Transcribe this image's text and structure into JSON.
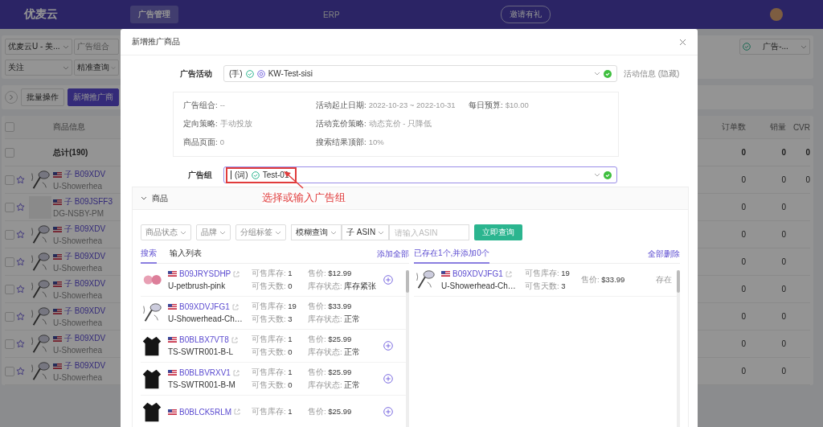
{
  "header": {
    "logo": "优麦云",
    "nav": [
      {
        "label": "广告管理",
        "selected": true
      },
      {
        "label": "ERP",
        "selected": false
      }
    ],
    "invite_button": "邀请有礼"
  },
  "filters": {
    "store": "优麦云U - 美...",
    "portfolio_placeholder": "广告组合",
    "follow": "关注",
    "search_mode": "精准查询",
    "ad_status": "广告-..."
  },
  "toolbar": {
    "bulk_button": "批量操作",
    "add_button": "新增推广商"
  },
  "table": {
    "columns": [
      "商品信息",
      "订单数",
      "销量",
      "CVR"
    ],
    "header_checked": false,
    "total": {
      "label": "总计(190)",
      "checked": false,
      "orders": "0",
      "sales": "0",
      "cvr": "0"
    },
    "rows": [
      {
        "kind": "showerhead",
        "checked": false,
        "asin": "子 B09XDV",
        "name": "U-Showerhea",
        "orders": "0",
        "sales": "0",
        "cvr": "0"
      },
      {
        "kind": "blank",
        "checked": false,
        "asin": "子 B09JSFF3",
        "name": "DG-NSBY-PM",
        "orders": "0",
        "sales": "0"
      },
      {
        "kind": "showerhead",
        "checked": false,
        "asin": "子 B09XDV",
        "name": "U-Showerhea",
        "orders": "0",
        "sales": "0"
      },
      {
        "kind": "showerhead",
        "checked": false,
        "asin": "子 B09XDV",
        "name": "U-Showerhea",
        "orders": "0",
        "sales": "0"
      },
      {
        "kind": "showerhead",
        "checked": false,
        "asin": "子 B09XDV",
        "name": "U-Showerhea",
        "orders": "0",
        "sales": "0"
      },
      {
        "kind": "showerhead",
        "checked": false,
        "asin": "子 B09XDV",
        "name": "U-Showerhea",
        "orders": "0",
        "sales": "0"
      },
      {
        "kind": "showerhead",
        "checked": false,
        "asin": "子 B09XDV",
        "name": "U-Showerhea",
        "orders": "0",
        "sales": "0"
      },
      {
        "kind": "showerhead",
        "checked": false,
        "asin": "子 B09XDV",
        "name": "U-Showerhea",
        "orders": "0",
        "sales": "0"
      }
    ]
  },
  "modal": {
    "title": "新增推广商品",
    "campaign": {
      "label": "广告活动",
      "prefix": "(手)",
      "value": "KW-Test-sisi",
      "side_link": "活动信息 (隐藏)"
    },
    "info_rows": [
      [
        {
          "label": "广告组合:",
          "value": "--"
        },
        {
          "label": "活动起止日期:",
          "value": "2022-10-23 ~ 2022-10-31"
        },
        {
          "label": "每日预算:",
          "value": "$10.00"
        }
      ],
      [
        {
          "label": "定向策略:",
          "value": "手动投放"
        },
        {
          "label": "活动竞价策略:",
          "value": "动态竞价 - 只降低"
        }
      ],
      [
        {
          "label": "商品页面:",
          "value": "0"
        },
        {
          "label": "搜索结果顶部:",
          "value": "10%"
        }
      ]
    ],
    "ad_group": {
      "label": "广告组",
      "prefix": "(词)",
      "value": "Test-01"
    },
    "annotation": "选择或输入广告组",
    "products": {
      "title": "商品",
      "expanded": true,
      "filters": [
        "商品状态",
        "品牌",
        "分组标签"
      ],
      "match_mode": "模糊查询",
      "asin_type": "子 ASIN",
      "asin_placeholder": "请输入ASIN",
      "query_button": "立即查询",
      "tabs": [
        {
          "label": "搜索",
          "selected": true
        },
        {
          "label": "输入列表",
          "selected": false
        }
      ],
      "add_all": "添加全部",
      "added_tab": {
        "label": "已存在1个,并添加0个",
        "selected": true
      },
      "remove_all": "全部删除",
      "items": [
        {
          "kind": "brush",
          "asin": "B09JRYSDHP",
          "name": "U-petbrush-pink",
          "stock": [
            "可售库存:",
            "1"
          ],
          "days": [
            "可售天数:",
            "0"
          ],
          "price": [
            "售价:",
            "$12.99"
          ],
          "status": [
            "库存状态:",
            "库存紧张"
          ],
          "addable": true
        },
        {
          "kind": "showerhead",
          "asin": "B09XDVJFG1",
          "name": "U-Showerhead-Ch…",
          "stock": [
            "可售库存:",
            "19"
          ],
          "days": [
            "可售天数:",
            "3"
          ],
          "price": [
            "售价:",
            "$33.99"
          ],
          "status": [
            "库存状态:",
            "正常"
          ],
          "addable": false
        },
        {
          "kind": "sweater",
          "asin": "B0BLBX7VT8",
          "name": "TS-SWTR001-B-L",
          "stock": [
            "可售库存:",
            "1"
          ],
          "days": [
            "可售天数:",
            "0"
          ],
          "price": [
            "售价:",
            "$25.99"
          ],
          "status": [
            "库存状态:",
            "正常"
          ],
          "addable": true
        },
        {
          "kind": "sweater",
          "asin": "B0BLBVRXV1",
          "name": "TS-SWTR001-B-M",
          "stock": [
            "可售库存:",
            "1"
          ],
          "days": [
            "可售天数:",
            "0"
          ],
          "price": [
            "售价:",
            "$25.99"
          ],
          "status": [
            "库存状态:",
            "正常"
          ],
          "addable": true
        },
        {
          "kind": "sweater",
          "asin": "B0BLCK5RLM",
          "stock": [
            "可售库存:",
            "1"
          ],
          "price": [
            "售价:",
            "$25.99"
          ],
          "addable": true
        }
      ],
      "added_items": [
        {
          "kind": "showerhead",
          "asin": "B09XDVJFG1",
          "name": "U-Showerhead-Ch…",
          "stock": [
            "可售库存:",
            "19"
          ],
          "days": [
            "可售天数:",
            "3"
          ],
          "price": [
            "售价:",
            "$33.99"
          ],
          "state": "存在"
        }
      ]
    }
  }
}
